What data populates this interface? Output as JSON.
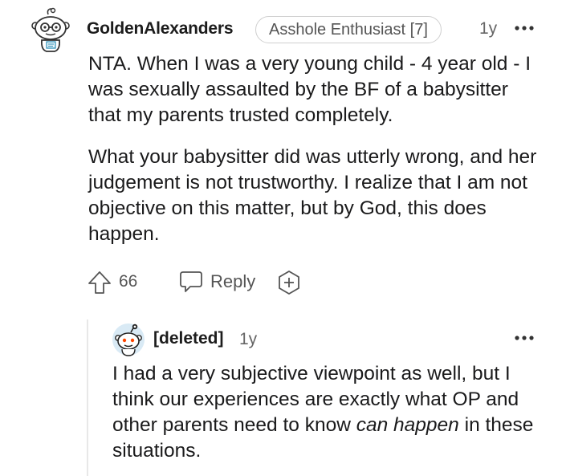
{
  "comment": {
    "author": "GoldenAlexanders",
    "flair": "Asshole Enthusiast [7]",
    "time": "1y",
    "paragraphs": [
      "NTA. When I was a very young child - 4 year old - I was sexually assaulted by the BF of a babysitter that my parents trusted completely.",
      "What your babysitter did was utterly wrong, and her judgement is not trustworthy. I realize that I am not objective on this matter, but by God, this does happen."
    ],
    "score": "66",
    "reply_label": "Reply"
  },
  "reply": {
    "author": "[deleted]",
    "time": "1y",
    "text_plain": "I had a very subjective viewpoint as well, but I think our experiences are exactly what OP and other parents need to know ",
    "text_italic": "can happen",
    "text_end": " in these situations."
  },
  "icons": {
    "more": "more-options-icon",
    "upvote": "upvote-arrow-icon",
    "reply": "speech-bubble-icon",
    "award": "award-plus-icon"
  },
  "colors": {
    "text": "#1a1a1b",
    "meta": "#666666",
    "flair_border": "#cfcfcf",
    "thread_line": "#e8e8e8"
  }
}
